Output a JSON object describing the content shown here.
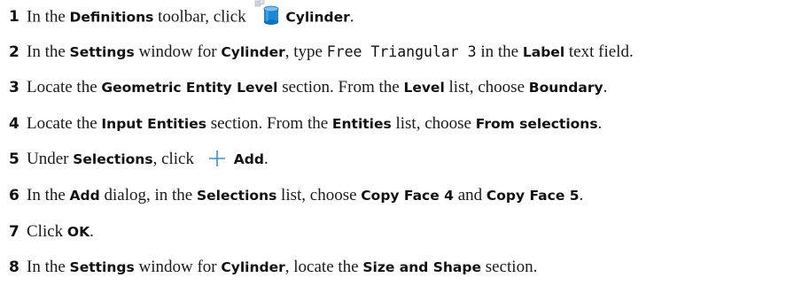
{
  "steps": [
    {
      "num": "1",
      "t1": "In the ",
      "b1": "Definitions",
      "t2": " toolbar, click",
      "icon": "cylinder-icon",
      "b2": "Cylinder",
      "t3": "."
    },
    {
      "num": "2",
      "t1": "In the ",
      "b1": "Settings",
      "t2": " window for ",
      "b2": "Cylinder",
      "t3": ", type ",
      "code": "Free Triangular 3",
      "t4": " in the ",
      "b3": "Label",
      "t5": " text field."
    },
    {
      "num": "3",
      "t1": "Locate the ",
      "b1": "Geometric Entity Level",
      "t2": " section. From the ",
      "b2": "Level",
      "t3": " list, choose ",
      "b3": "Boundary",
      "t4": "."
    },
    {
      "num": "4",
      "t1": "Locate the ",
      "b1": "Input Entities",
      "t2": " section. From the ",
      "b2": "Entities",
      "t3": " list, choose ",
      "b3": "From selections",
      "t4": "."
    },
    {
      "num": "5",
      "t1": "Under ",
      "b1": "Selections",
      "t2": ", click",
      "icon": "plus-icon",
      "b2": "Add",
      "t3": "."
    },
    {
      "num": "6",
      "t1": "In the ",
      "b1": "Add",
      "t2": " dialog, in the ",
      "b2": "Selections",
      "t3": " list, choose ",
      "b3": "Copy Face 4",
      "t4": " and ",
      "b4": "Copy Face 5",
      "t5": "."
    },
    {
      "num": "7",
      "t1": "Click ",
      "b1": "OK",
      "t2": "."
    },
    {
      "num": "8",
      "t1": "In the ",
      "b1": "Settings",
      "t2": " window for ",
      "b2": "Cylinder",
      "t3": ", locate the ",
      "b3": "Size and Shape",
      "t4": " section."
    }
  ],
  "colors": {
    "text": "#1a1a1a",
    "cylinder_icon_blue": "#1e88d6",
    "plus_icon_blue": "#3a8fd6"
  }
}
